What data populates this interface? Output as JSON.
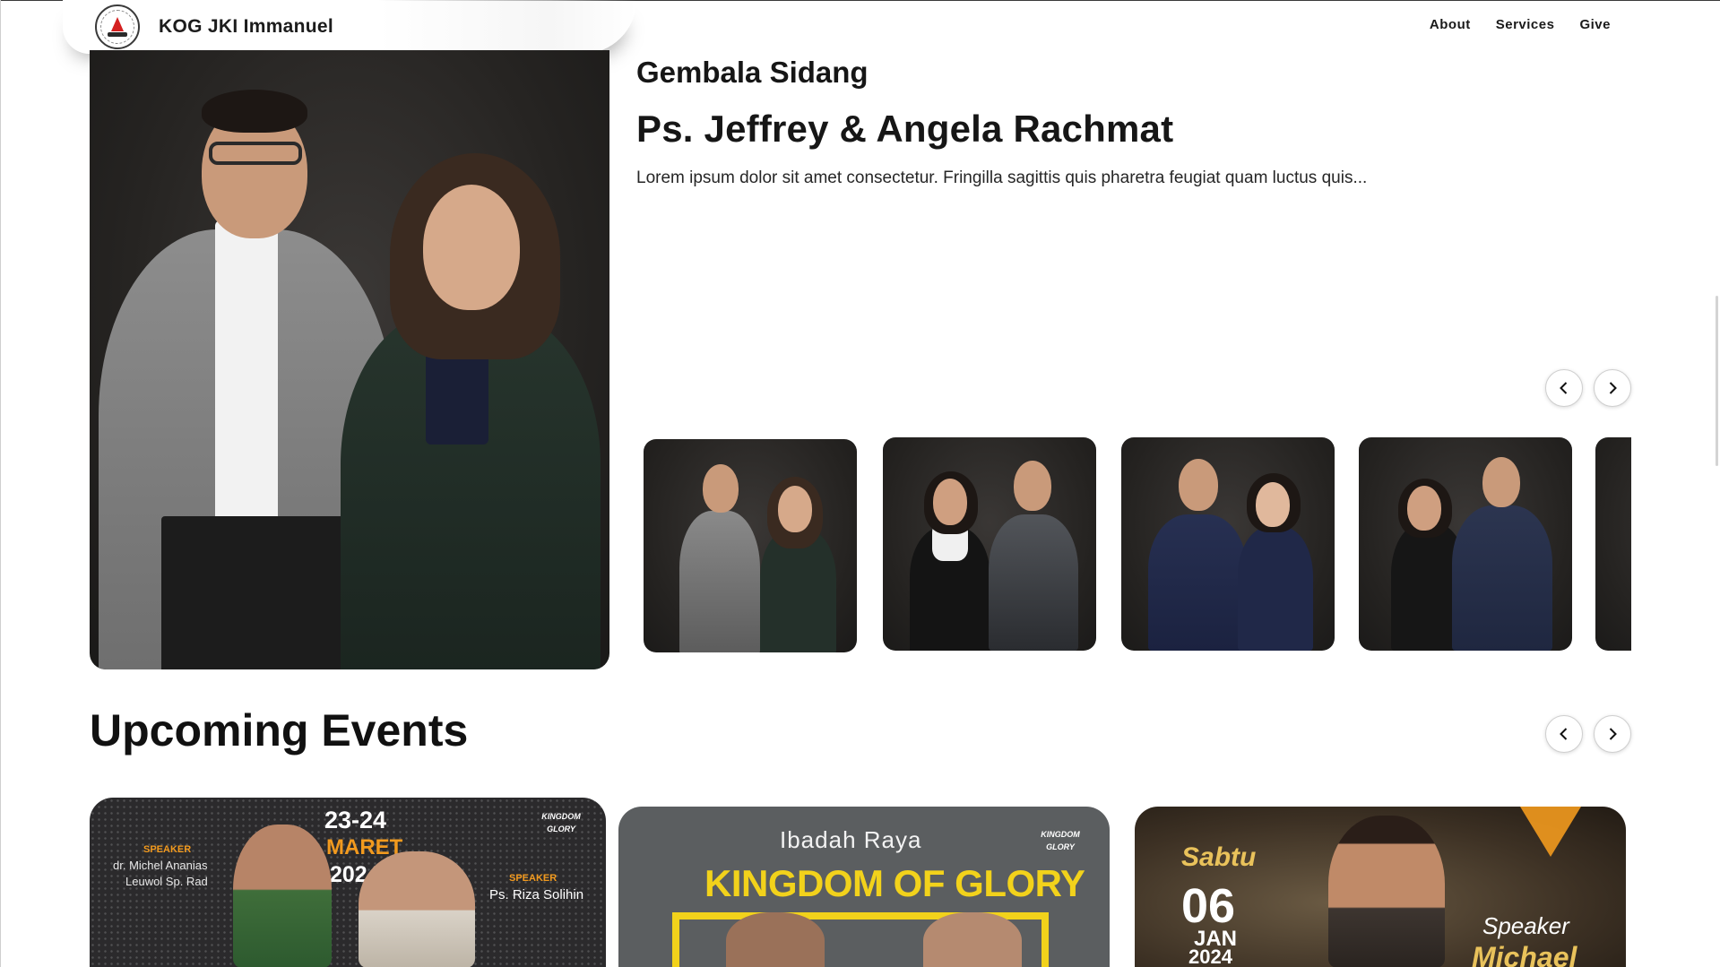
{
  "header": {
    "brand_name": "KOG JKI Immanuel",
    "nav": [
      {
        "label": "About"
      },
      {
        "label": "Services"
      },
      {
        "label": "Give"
      }
    ]
  },
  "pastor": {
    "eyebrow": "Gembala Sidang",
    "name": "Ps. Jeffrey & Angela Rachmat",
    "description": "Lorem ipsum dolor sit amet consectetur. Fringilla sagittis quis pharetra feugiat quam luctus quis..."
  },
  "events": {
    "title": "Upcoming Events",
    "cards": [
      {
        "date_line1": "23-24",
        "date_line2": "MARET",
        "date_line3": "2024",
        "speaker_tag_left": "SPEAKER",
        "speaker_left": "dr. Michel Ananias",
        "speaker_left_2": "Leuwol Sp. Rad",
        "speaker_tag_right": "SPEAKER",
        "speaker_right": "Ps. Riza Solihin",
        "badge": "KINGDOM GLORY"
      },
      {
        "subtitle": "Ibadah Raya",
        "title": "KINGDOM OF GLORY",
        "badge": "KINGDOM GLORY"
      },
      {
        "day": "Sabtu",
        "date": "06",
        "month": "JAN",
        "year": "2024",
        "speaker_tag": "Speaker",
        "speaker": "Michael"
      }
    ]
  },
  "colors": {
    "accent_yellow": "#f2d21b",
    "accent_orange": "#f29a1e",
    "text_dark": "#161616"
  }
}
